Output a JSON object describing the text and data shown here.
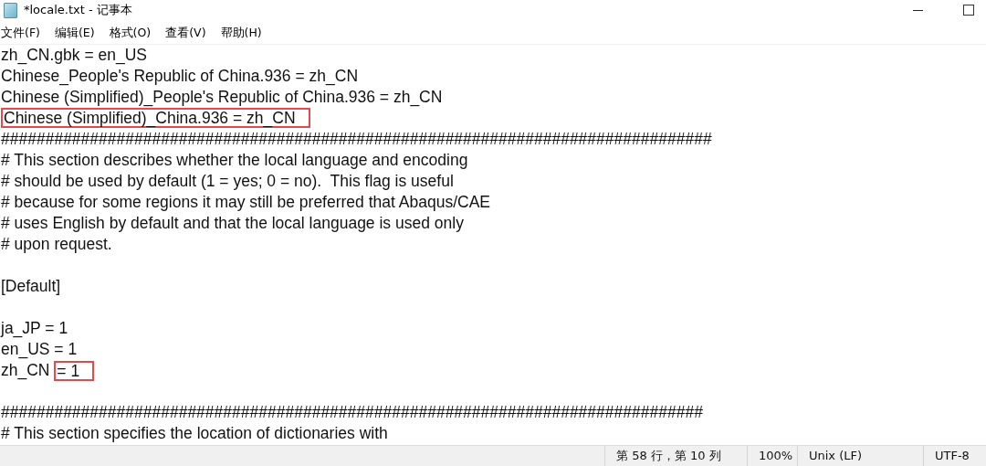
{
  "window": {
    "title": "*locale.txt - 记事本",
    "controls": [
      {
        "kind": "minimize"
      },
      {
        "kind": "maximize"
      }
    ]
  },
  "menu": [
    "文件(F)",
    "编辑(E)",
    "格式(O)",
    "查看(V)",
    "帮助(H)"
  ],
  "lines": [
    {
      "kind": "text",
      "segments": [
        {
          "text": "zh_CN.gbk = en_US",
          "boxed": false
        }
      ]
    },
    {
      "kind": "text",
      "segments": [
        {
          "text": "Chinese_People's Republic of China.936 = zh_CN",
          "boxed": false
        }
      ]
    },
    {
      "kind": "text",
      "segments": [
        {
          "text": "Chinese (Simplified)_People's Republic of China.936 = zh_CN",
          "boxed": false
        }
      ]
    },
    {
      "kind": "text",
      "segments": [
        {
          "text": "Chinese (Simplified)_China.936 = zh_CN",
          "boxed": true
        }
      ]
    },
    {
      "kind": "text",
      "segments": [
        {
          "text": "################################################################################",
          "boxed": false
        }
      ]
    },
    {
      "kind": "text",
      "segments": [
        {
          "text": "# This section describes whether the local language and encoding",
          "boxed": false
        }
      ]
    },
    {
      "kind": "text",
      "segments": [
        {
          "text": "# should be used by default (1 = yes; 0 = no).  This flag is useful",
          "boxed": false
        }
      ]
    },
    {
      "kind": "text",
      "segments": [
        {
          "text": "# because for some regions it may still be preferred that Abaqus/CAE",
          "boxed": false
        }
      ]
    },
    {
      "kind": "text",
      "segments": [
        {
          "text": "# uses English by default and that the local language is used only",
          "boxed": false
        }
      ]
    },
    {
      "kind": "text",
      "segments": [
        {
          "text": "# upon request.",
          "boxed": false
        }
      ]
    },
    {
      "kind": "blank"
    },
    {
      "kind": "text",
      "segments": [
        {
          "text": "[Default]",
          "boxed": false
        }
      ]
    },
    {
      "kind": "blank"
    },
    {
      "kind": "text",
      "segments": [
        {
          "text": "ja_JP = 1",
          "boxed": false
        }
      ]
    },
    {
      "kind": "text",
      "segments": [
        {
          "text": "en_US = 1",
          "boxed": false
        }
      ]
    },
    {
      "kind": "text",
      "segments": [
        {
          "text": "zh_CN ",
          "boxed": false
        },
        {
          "text": "= 1",
          "boxed": true
        }
      ]
    },
    {
      "kind": "blank"
    },
    {
      "kind": "text",
      "segments": [
        {
          "text": "###############################################################################",
          "boxed": false
        }
      ]
    },
    {
      "kind": "text",
      "segments": [
        {
          "text": "# This section specifies the location of dictionaries with",
          "boxed": false
        }
      ]
    }
  ],
  "status_bar": [
    "第 58 行，第 10 列",
    "100%",
    "Unix (LF)",
    "UTF-8"
  ]
}
